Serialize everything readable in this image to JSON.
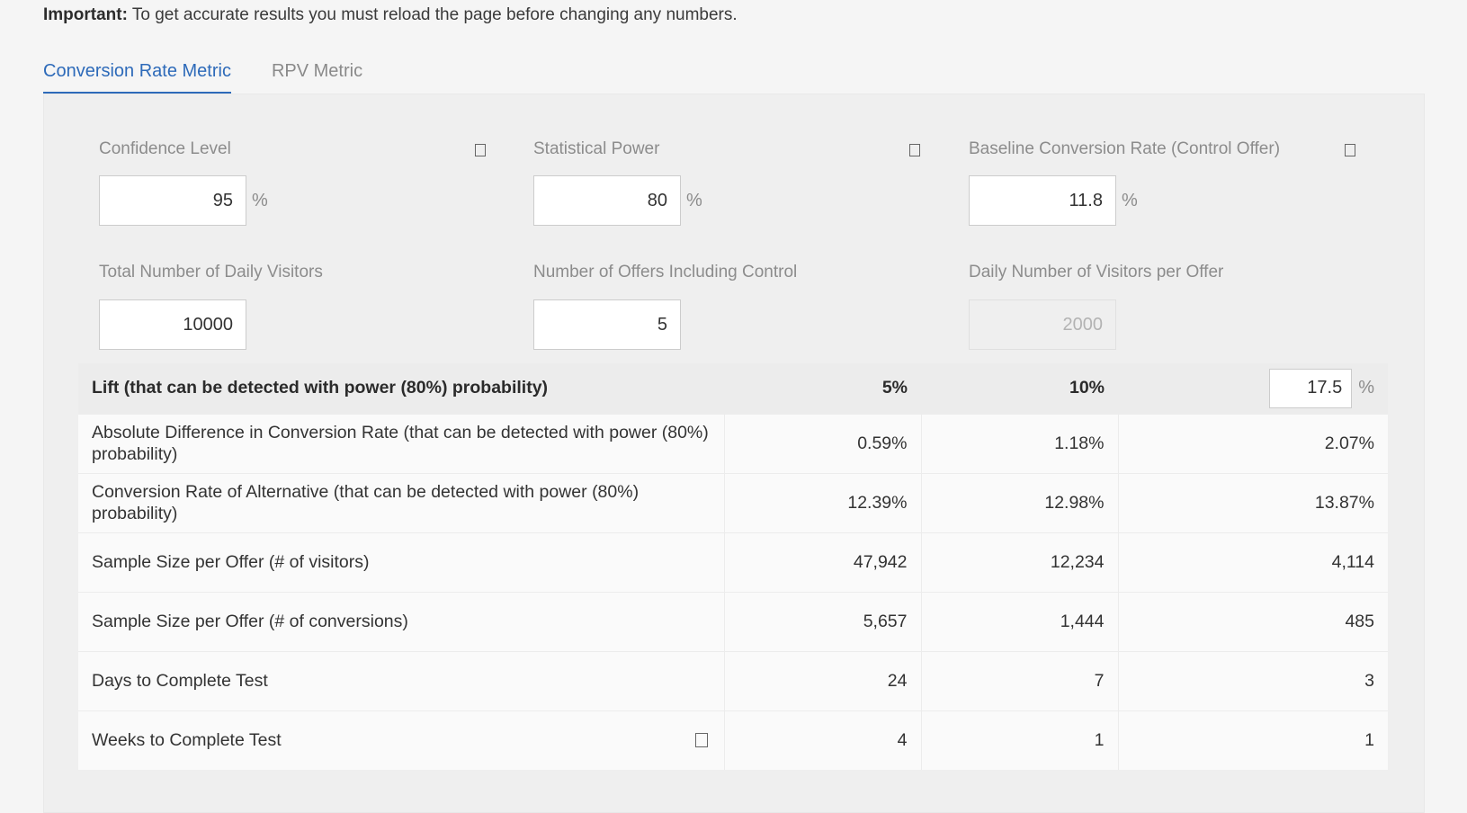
{
  "notice": {
    "bold": "Important:",
    "text": " To get accurate results you must reload the page before changing any numbers."
  },
  "tabs": [
    {
      "label": "Conversion Rate Metric",
      "active": true
    },
    {
      "label": "RPV Metric",
      "active": false
    }
  ],
  "fields": {
    "confidence_level": {
      "label": "Confidence Level",
      "value": "95",
      "unit": "%"
    },
    "statistical_power": {
      "label": "Statistical Power",
      "value": "80",
      "unit": "%"
    },
    "baseline_conversion_rate": {
      "label": "Baseline Conversion Rate (Control Offer)",
      "value": "11.8",
      "unit": "%"
    },
    "daily_visitors": {
      "label": "Total Number of Daily Visitors",
      "value": "10000"
    },
    "offers_count": {
      "label": "Number of Offers Including Control",
      "value": "5"
    },
    "visitors_per_offer": {
      "label": "Daily Number of Visitors per Offer",
      "value": "2000"
    }
  },
  "results": {
    "header": {
      "label": "Lift (that can be detected with power (80%) probability)",
      "col1": "5%",
      "col2": "10%",
      "custom_lift_value": "17.5",
      "custom_lift_unit": "%"
    },
    "rows": [
      {
        "label": "Absolute Difference in Conversion Rate (that can be detected with power (80%) probability)",
        "values": [
          "0.59%",
          "1.18%",
          "2.07%"
        ]
      },
      {
        "label": "Conversion Rate of Alternative (that can be detected with power (80%) probability)",
        "values": [
          "12.39%",
          "12.98%",
          "13.87%"
        ]
      },
      {
        "label": "Sample Size per Offer (# of visitors)",
        "values": [
          "47,942",
          "12,234",
          "4,114"
        ]
      },
      {
        "label": "Sample Size per Offer (# of conversions)",
        "values": [
          "5,657",
          "1,444",
          "485"
        ]
      },
      {
        "label": "Days to Complete Test",
        "values": [
          "24",
          "7",
          "3"
        ]
      },
      {
        "label": "Weeks to Complete Test",
        "values": [
          "4",
          "1",
          "1"
        ]
      }
    ]
  }
}
